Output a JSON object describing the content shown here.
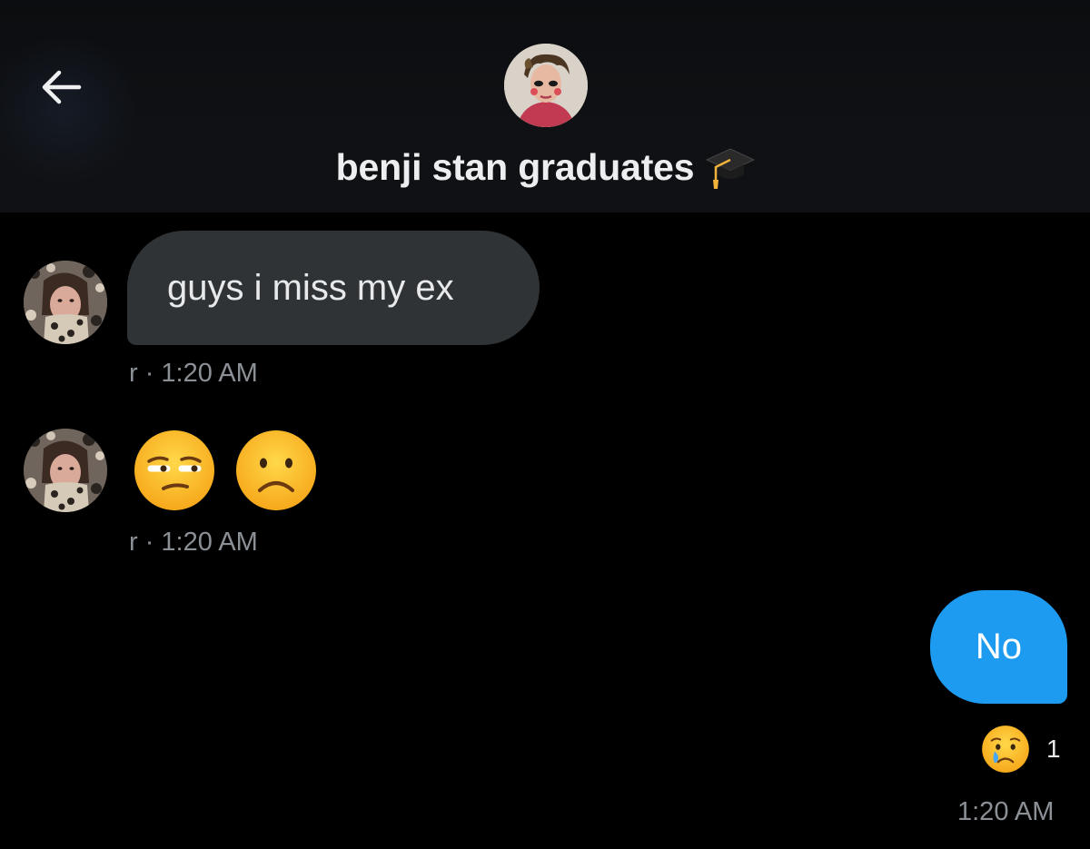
{
  "header": {
    "back_icon": "arrow-left-icon",
    "title": "benji stan graduates",
    "title_emoji": "graduation-cap-icon",
    "avatar": "group-avatar"
  },
  "messages": [
    {
      "direction": "incoming",
      "text": "guys i miss my ex",
      "meta": "r · 1:20 AM"
    },
    {
      "direction": "incoming",
      "emojis": [
        "unamused-face-icon",
        "frowning-face-icon"
      ],
      "meta": "r · 1:20 AM"
    },
    {
      "direction": "outgoing",
      "text": "No",
      "reaction": {
        "icon": "crying-face-icon",
        "count": "1"
      },
      "meta": "1:20 AM"
    }
  ],
  "colors": {
    "background": "#000000",
    "header_bg": "#0f1114",
    "incoming_bubble": "#2f3336",
    "outgoing_bubble": "#1d9bf0",
    "meta_text": "#8b9096",
    "primary_text": "#e7e9ea"
  }
}
